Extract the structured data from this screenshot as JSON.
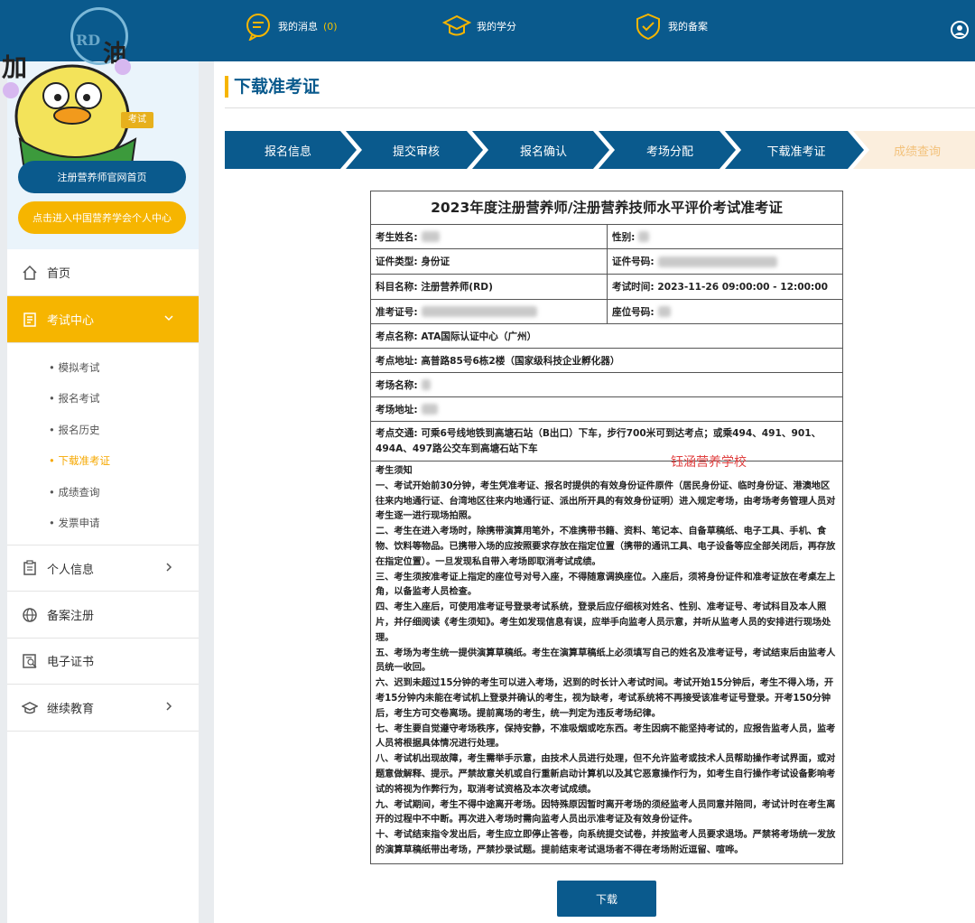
{
  "topbar": {
    "messages_label": "我的消息",
    "messages_count": "(0)",
    "credits_label": "我的学分",
    "filing_label": "我的备案"
  },
  "sidebar": {
    "mascot_text": "加油",
    "logo_text": "RD",
    "badge_text": "考试",
    "official_button": "注册营养师官网首页",
    "society_button": "点击进入中国营养学会个人中心",
    "items": [
      {
        "label": "首页",
        "icon": "home-icon"
      },
      {
        "label": "考试中心",
        "icon": "exam-icon",
        "active": true
      },
      {
        "label": "个人信息",
        "icon": "clipboard-icon"
      },
      {
        "label": "备案注册",
        "icon": "globe-icon"
      },
      {
        "label": "电子证书",
        "icon": "certificate-icon"
      },
      {
        "label": "继续教育",
        "icon": "graduation-cap-icon"
      }
    ],
    "subitems": [
      {
        "label": "• 模拟考试"
      },
      {
        "label": "• 报名考试"
      },
      {
        "label": "• 报名历史"
      },
      {
        "label": "• 下载准考证",
        "active": true
      },
      {
        "label": "• 成绩查询"
      },
      {
        "label": "• 发票申请"
      }
    ]
  },
  "main": {
    "title": "下载准考证",
    "steps": [
      "报名信息",
      "提交审核",
      "报名确认",
      "考场分配",
      "下载准考证",
      "成绩查询"
    ],
    "download_button": "下载",
    "watermark": "钰涵营养学校"
  },
  "ticket": {
    "title": "2023年度注册营养师/注册营养技师水平评价考试准考证",
    "name_label": "考生姓名:",
    "gender_label": "性别:",
    "id_type_label": "证件类型:",
    "id_type_value": "身份证",
    "id_no_label": "证件号码:",
    "subject_label": "科目名称:",
    "subject_value": "注册营养师(RD)",
    "time_label": "考试时间:",
    "time_value": "2023-11-26 09:00:00 - 12:00:00",
    "ticket_no_label": "准考证号:",
    "seat_label": "座位号码:",
    "site_name_label": "考点名称:",
    "site_name_value": "ATA国际认证中心（广州）",
    "site_addr_label": "考点地址:",
    "site_addr_value": "高普路85号6栋2楼（国家级科技企业孵化器）",
    "room_name_label": "考场名称:",
    "room_addr_label": "考场地址:",
    "transport_label": "考点交通:",
    "transport_value": "可乘6号线地铁到高塘石站（B出口）下车，步行700米可到达考点；或乘494、491、901、494A、497路公交车到高塘石站下车",
    "notice_title": "考生须知",
    "notices": [
      "一、考试开始前30分钟，考生凭准考证、报名时提供的有效身份证件原件（居民身份证、临时身份证、港澳地区往来内地通行证、台湾地区往来内地通行证、派出所开具的有效身份证明）进入规定考场，由考场考务管理人员对考生逐一进行现场拍照。",
      "二、考生在进入考场时，除携带演算用笔外，不准携带书籍、资料、笔记本、自备草稿纸、电子工具、手机、食物、饮料等物品。已携带入场的应按照要求存放在指定位置（携带的通讯工具、电子设备等应全部关闭后，再存放在指定位置）。一旦发现私自带入考场即取消考试成绩。",
      "三、考生须按准考证上指定的座位号对号入座，不得随意调换座位。入座后，须将身份证件和准考证放在考桌左上角，以备监考人员检查。",
      "四、考生入座后，可使用准考证号登录考试系统，登录后应仔细核对姓名、性别、准考证号、考试科目及本人照片，并仔细阅读《考生须知》。考生如发现信息有误，应举手向监考人员示意，并听从监考人员的安排进行现场处理。",
      "五、考场为考生统一提供演算草稿纸。考生在演算草稿纸上必须填写自己的姓名及准考证号，考试结束后由监考人员统一收回。",
      "六、迟到未超过15分钟的考生可以进入考场，迟到的时长计入考试时间。考试开始15分钟后，考生不得入场，开考15分钟内未能在考试机上登录并确认的考生，视为缺考，考试系统将不再接受该准考证号登录。开考150分钟后，考生方可交卷离场。提前离场的考生，统一判定为违反考场纪律。",
      "七、考生要自觉遵守考场秩序，保持安静，不准吸烟或吃东西。考生因病不能坚持考试的，应报告监考人员，监考人员将根据具体情况进行处理。",
      "八、考试机出现故障，考生需举手示意，由技术人员进行处理，但不允许监考或技术人员帮助操作考试界面，或对题意做解释、提示。严禁故意关机或自行重新启动计算机以及其它恶意操作行为，如考生自行操作考试设备影响考试的将视为作弊行为，取消考试资格及本次考试成绩。",
      "九、考试期间，考生不得中途离开考场。因特殊原因暂时离开考场的须经监考人员同意并陪同，考试计时在考生离开的过程中不中断。再次进入考场时需向监考人员出示准考证及有效身份证件。",
      "十、考试结束指令发出后，考生应立即停止答卷，向系统提交试卷，并按监考人员要求退场。严禁将考场统一发放的演算草稿纸带出考场，严禁抄录试题。提前结束考试退场者不得在考场附近逗留、喧哗。"
    ]
  }
}
